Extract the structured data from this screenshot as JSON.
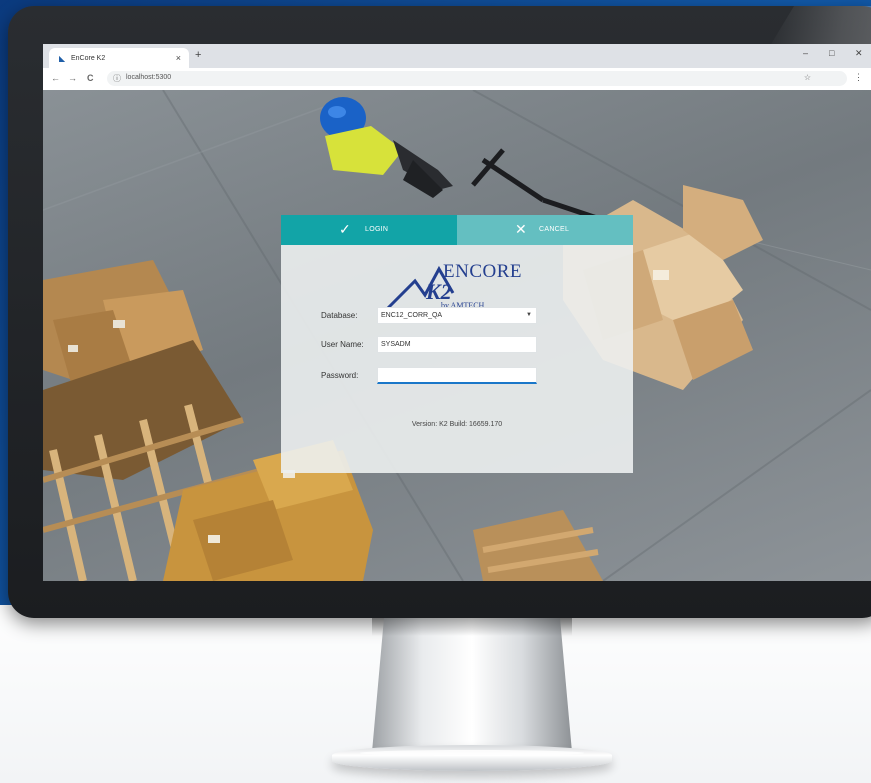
{
  "browser": {
    "tab_title": "EnCore K2",
    "tab_close": "×",
    "new_tab": "+",
    "window_controls": [
      "–",
      "□",
      "✕"
    ],
    "nav": {
      "back": "←",
      "forward": "→",
      "reload": "C"
    },
    "url": "localhost:5300"
  },
  "dialog": {
    "login_label": "LOGIN",
    "cancel_label": "CANCEL",
    "logo": {
      "brand": "ENCORE",
      "product": "K2",
      "company": "by AMTECH"
    },
    "fields": {
      "database": {
        "label": "Database:",
        "value": "ENC12_CORR_QA"
      },
      "username": {
        "label": "User Name:",
        "value": "SYSADM"
      },
      "password": {
        "label": "Password:",
        "value": ""
      }
    },
    "version": "Version: K2    Build: 16659.170"
  },
  "colors": {
    "accent_teal": "#12a4a7",
    "cancel_teal": "#64bfc1",
    "focus_blue": "#1a77c9",
    "logo_blue": "#243f8f",
    "background_blue": "#0f4c93"
  },
  "icons": {
    "login": "check-icon",
    "cancel": "close-icon",
    "favicon": "encore-favicon-icon",
    "info": "info-icon",
    "bookmark": "star-icon",
    "menu": "kebab-menu-icon"
  }
}
